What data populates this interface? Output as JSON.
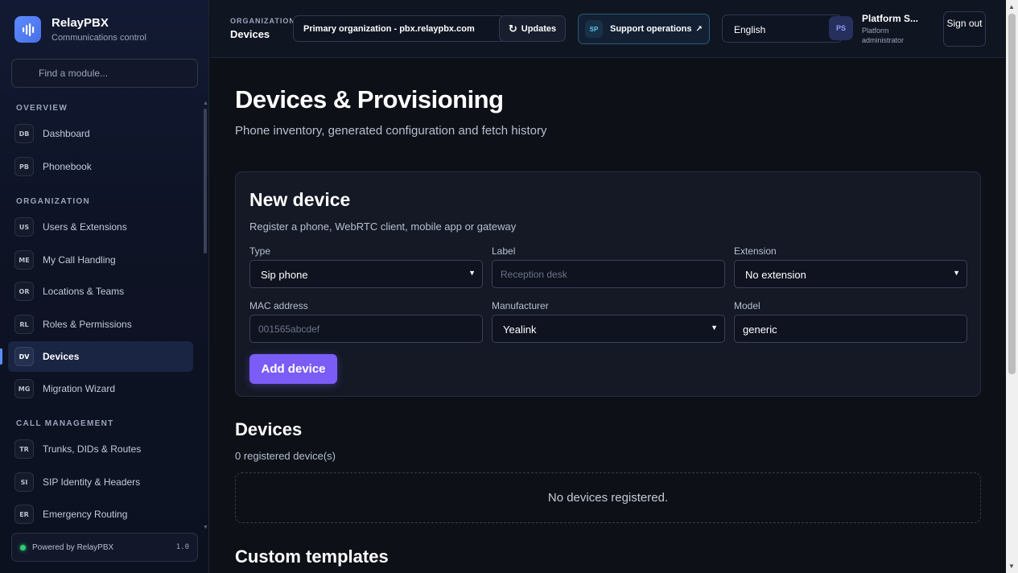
{
  "brand": {
    "name": "RelayPBX",
    "subtitle": "Communications control"
  },
  "sidebar": {
    "search_placeholder": "Find a module...",
    "sections": [
      {
        "title": "OVERVIEW",
        "items": [
          {
            "code": "DB",
            "label": "Dashboard"
          },
          {
            "code": "PB",
            "label": "Phonebook"
          }
        ]
      },
      {
        "title": "ORGANIZATION",
        "items": [
          {
            "code": "US",
            "label": "Users & Extensions"
          },
          {
            "code": "ME",
            "label": "My Call Handling"
          },
          {
            "code": "OR",
            "label": "Locations & Teams"
          },
          {
            "code": "RL",
            "label": "Roles & Permissions"
          },
          {
            "code": "DV",
            "label": "Devices",
            "active": true
          },
          {
            "code": "MG",
            "label": "Migration Wizard"
          }
        ]
      },
      {
        "title": "CALL MANAGEMENT",
        "items": [
          {
            "code": "TR",
            "label": "Trunks, DIDs & Routes"
          },
          {
            "code": "SI",
            "label": "SIP Identity & Headers"
          },
          {
            "code": "ER",
            "label": "Emergency Routing"
          }
        ]
      }
    ],
    "footer": {
      "text": "Powered by RelayPBX",
      "version": "1.0"
    }
  },
  "topbar": {
    "crumb_section": "ORGANIZATION",
    "crumb_page": "Devices",
    "org_select": "Primary organization - pbx.relaypbx.com",
    "updates_label": "Updates",
    "support_badge": "SP",
    "support_label": "Support operations",
    "language": "English",
    "user_initials": "PS",
    "user_name": "Platform S...",
    "user_role": "Platform administrator",
    "signout_label": "Sign out"
  },
  "page": {
    "title": "Devices & Provisioning",
    "subtitle": "Phone inventory, generated configuration and fetch history"
  },
  "new_device": {
    "title": "New device",
    "subtitle": "Register a phone, WebRTC client, mobile app or gateway",
    "type_label": "Type",
    "type_value": "Sip phone",
    "label_label": "Label",
    "label_placeholder": "Reception desk",
    "extension_label": "Extension",
    "extension_value": "No extension",
    "mac_label": "MAC address",
    "mac_placeholder": "001565abcdef",
    "manufacturer_label": "Manufacturer",
    "manufacturer_value": "Yealink",
    "model_label": "Model",
    "model_value": "generic",
    "add_button": "Add device"
  },
  "devices": {
    "title": "Devices",
    "count_text": "0 registered device(s)",
    "empty_text": "No devices registered."
  },
  "custom_templates": {
    "title": "Custom templates"
  },
  "colors": {
    "accent": "#7b5cf6",
    "brand": "#5b8cff",
    "status_online": "#2ecc71"
  }
}
